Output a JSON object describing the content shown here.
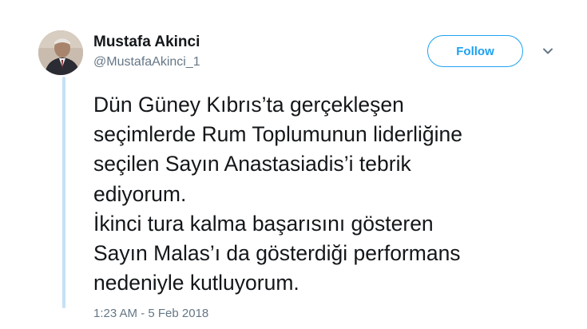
{
  "author": {
    "name": "Mustafa Akinci",
    "handle": "@MustafaAkinci_1"
  },
  "follow_button": {
    "label": "Follow"
  },
  "menu": {
    "icon": "chevron-down-icon"
  },
  "tweet": {
    "lines": [
      "Dün Güney Kıbrıs’ta gerçekleşen",
      "seçimlerde Rum Toplumunun liderliğine",
      "seçilen Sayın Anastasiadis’i tebrik",
      "ediyorum.",
      "İkinci tura kalma başarısını gösteren",
      "Sayın Malas’ı da gösterdiği performans",
      "nedeniyle kutluyorum."
    ],
    "timestamp": "1:23 AM - 5 Feb 2018"
  },
  "colors": {
    "accent": "#1da1f2",
    "thread_line": "#c4e1f6",
    "text": "#14171a",
    "secondary_text": "#657786"
  }
}
